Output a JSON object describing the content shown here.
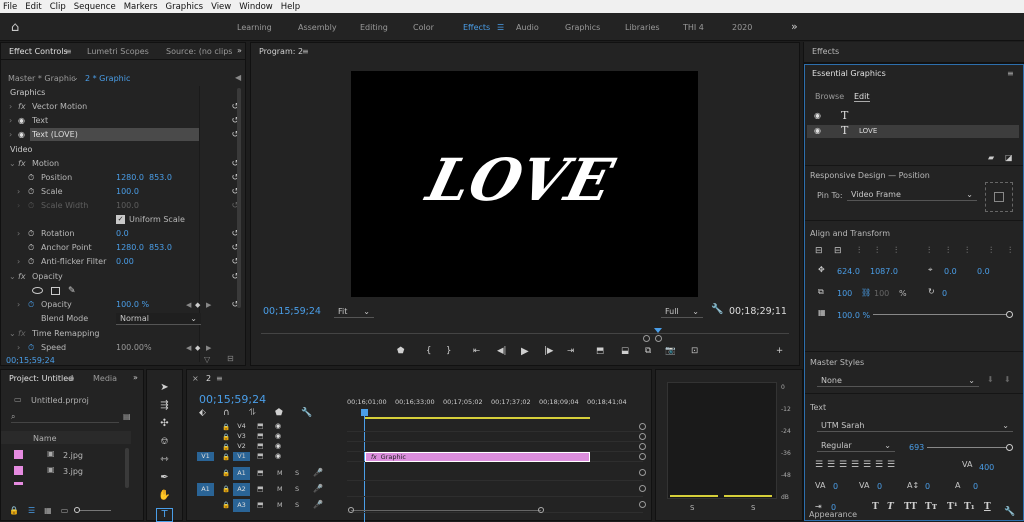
{
  "menu": [
    "File",
    "Edit",
    "Clip",
    "Sequence",
    "Markers",
    "Graphics",
    "View",
    "Window",
    "Help"
  ],
  "workspaces": [
    "Learning",
    "Assembly",
    "Editing",
    "Color",
    "Effects",
    "Audio",
    "Graphics",
    "Libraries",
    "THI 4",
    "2020"
  ],
  "workspace_active": "Effects",
  "ec": {
    "tabs": [
      "Effect Controls",
      "Lumetri Scopes",
      "Source: (no clips"
    ],
    "master": "Master * Graphic",
    "clip": "2 * Graphic",
    "graphics_header": "Graphics",
    "vector_motion": "Vector Motion",
    "text": "Text",
    "text_love": "Text (LOVE)",
    "video_header": "Video",
    "motion": "Motion",
    "position_label": "Position",
    "position_x": "1280.0",
    "position_y": "853.0",
    "scale_label": "Scale",
    "scale_value": "100.0",
    "scale_width_label": "Scale Width",
    "scale_width_value": "100.0",
    "uniform_scale": "Uniform Scale",
    "rotation_label": "Rotation",
    "rotation_value": "0.0",
    "anchor_label": "Anchor Point",
    "anchor_x": "1280.0",
    "anchor_y": "853.0",
    "antiflicker_label": "Anti-flicker Filter",
    "antiflicker_value": "0.00",
    "opacity_header": "Opacity",
    "opacity_label": "Opacity",
    "opacity_value": "100.0 %",
    "blend_label": "Blend Mode",
    "blend_value": "Normal",
    "time_remap": "Time Remapping",
    "speed_label": "Speed",
    "speed_value": "100.00%",
    "timecode": "00;15;59;24"
  },
  "program": {
    "title": "Program: 2",
    "overlay_text": "LOVE",
    "timecode": "00;15;59;24",
    "fit": "Fit",
    "quality": "Full",
    "duration": "00;18;29;11"
  },
  "project": {
    "tabs": [
      "Project: Untitled",
      "Media"
    ],
    "file": "Untitled.prproj",
    "col_name": "Name",
    "items": [
      {
        "name": "2.jpg",
        "color": "#e58be0"
      },
      {
        "name": "3.jpg",
        "color": "#e58be0"
      }
    ]
  },
  "timeline": {
    "seq": "2",
    "timecode": "00;15;59;24",
    "ruler": [
      "00;16;01;00",
      "00;16;33;00",
      "00;17;05;02",
      "00;17;37;02",
      "00;18;09;04",
      "00;18;41;04"
    ],
    "video_tracks": [
      "V4",
      "V3",
      "V2",
      "V1"
    ],
    "audio_tracks": [
      "A1",
      "A2",
      "A3"
    ],
    "src_v": "V1",
    "src_a": "A1",
    "clip_label": "Graphic",
    "clip_fx": "fx"
  },
  "meter": {
    "ticks": [
      "0",
      "-12",
      "-24",
      "-36",
      "-48",
      "dB"
    ],
    "solo": [
      "S",
      "S"
    ]
  },
  "eg": {
    "effects_title": "Effects",
    "title": "Essential Graphics",
    "tabs": [
      "Browse",
      "Edit"
    ],
    "layers": [
      {
        "name": ""
      },
      {
        "name": "LOVE"
      }
    ],
    "responsive": "Responsive Design — Position",
    "pin_label": "Pin To:",
    "pin_value": "Video Frame",
    "align_title": "Align and Transform",
    "pos_x": "624.0",
    "pos_y": "1087.0",
    "anchor_x": "0.0",
    "anchor_y": "0.0",
    "scale_w": "100",
    "scale_h": "100",
    "scale_unit": "%",
    "rotation": "0",
    "opacity": "100.0 %",
    "master_styles_title": "Master Styles",
    "master_style": "None",
    "text_title": "Text",
    "font": "UTM Sarah",
    "style": "Regular",
    "size": "693",
    "tracking": "400",
    "kern_vals": [
      "0",
      "0",
      "0",
      "0",
      "0",
      "0"
    ],
    "appearance": "Appearance"
  }
}
